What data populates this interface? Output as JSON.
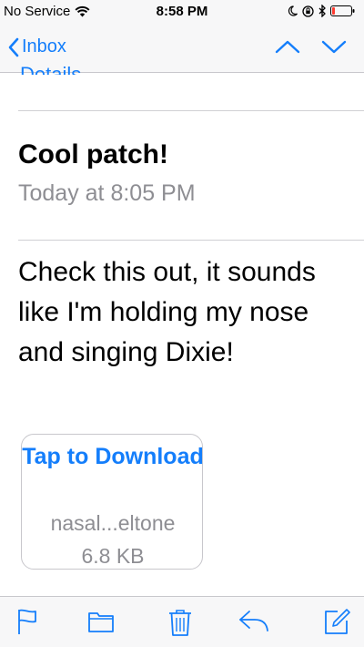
{
  "status_bar": {
    "carrier": "No Service",
    "time": "8:58 PM",
    "icons": [
      "wifi-icon",
      "moon-icon",
      "orientation-lock-icon",
      "bluetooth-icon",
      "battery-icon"
    ],
    "battery_level": 0.15
  },
  "nav": {
    "back_label": "Inbox",
    "icons": [
      "chevron-left-icon",
      "chevron-up-icon",
      "chevron-down-icon"
    ]
  },
  "header": {
    "details_link": "Details"
  },
  "message": {
    "subject": "Cool patch!",
    "date": "Today at 8:05 PM",
    "body": "Check this out, it sounds like I'm holding my nose and singing Dixie!"
  },
  "attachment": {
    "action": "Tap to Download",
    "filename": "nasal...eltone",
    "size": "6.8 KB"
  },
  "toolbar": {
    "icons": [
      "flag-icon",
      "folder-icon",
      "trash-icon",
      "reply-icon",
      "compose-icon"
    ]
  },
  "colors": {
    "accent": "#147efb",
    "secondary_text": "#8e8e93",
    "bar_background": "#f7f7f8",
    "battery_low": "#ff3b30"
  }
}
